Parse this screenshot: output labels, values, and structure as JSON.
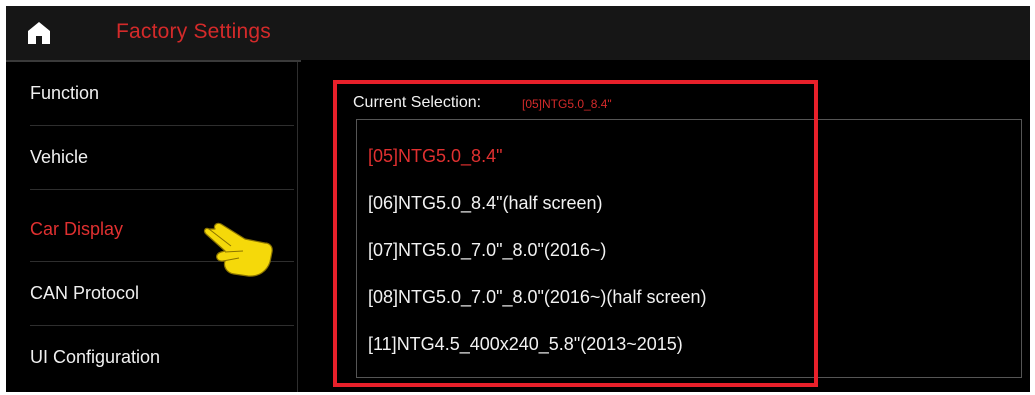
{
  "header": {
    "title": "Factory Settings",
    "icon": "home-icon"
  },
  "sidebar": {
    "items": [
      {
        "label": "Function"
      },
      {
        "label": "Vehicle"
      },
      {
        "label": "Car Display",
        "active": true
      },
      {
        "label": "CAN Protocol"
      },
      {
        "label": "UI Configuration"
      }
    ]
  },
  "pointer_icon": "pointing-hand-icon",
  "main": {
    "current_label": "Current Selection:",
    "current_value": "[05]NTG5.0_8.4\"",
    "options": [
      {
        "label": "[05]NTG5.0_8.4\"",
        "selected": true
      },
      {
        "label": "[06]NTG5.0_8.4\"(half screen)"
      },
      {
        "label": "[07]NTG5.0_7.0\"_8.0\"(2016~)"
      },
      {
        "label": "[08]NTG5.0_7.0\"_8.0\"(2016~)(half screen)"
      },
      {
        "label": "[11]NTG4.5_400x240_5.8\"(2013~2015)"
      }
    ]
  },
  "colors": {
    "accent": "#e03030",
    "highlight_frame": "#e8202a",
    "background": "#000000",
    "pointer": "#f5d90a"
  }
}
